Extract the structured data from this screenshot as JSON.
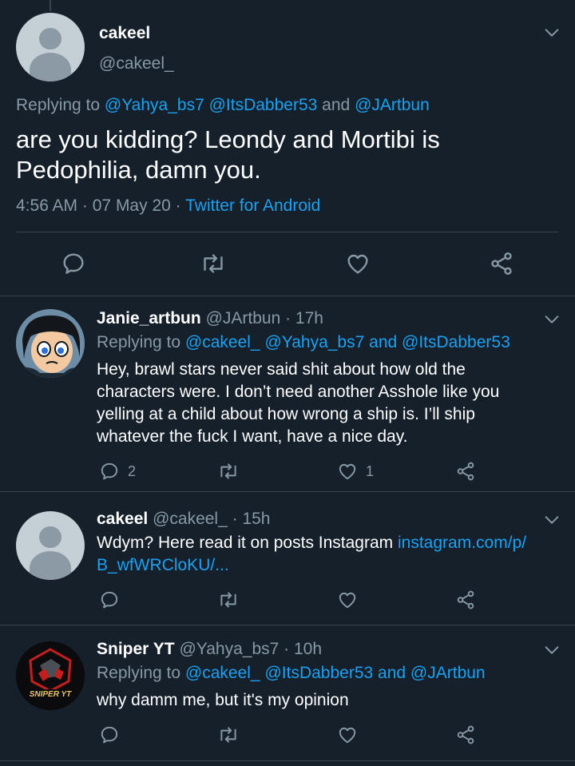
{
  "main_tweet": {
    "author_name": "cakeel",
    "author_handle": "@cakeel_",
    "replying_prefix": "Replying to",
    "replying_mentions": [
      "@Yahya_bs7",
      "@ItsDabber53"
    ],
    "replying_and": "and",
    "replying_last": "@JArtbun",
    "text_line1": "are you kidding? Leondy and Mortibi is",
    "text_line2": "Pedophilia, damn you.",
    "time": "4:56 AM",
    "dot": "·",
    "date": "07 May 20",
    "source": "Twitter for Android"
  },
  "replies": [
    {
      "name": "Janie_artbun",
      "handle": "@JArtbun",
      "age": "· 17h",
      "replying_prefix": "Replying to",
      "mention1": "@cakeel_",
      "mention2": "@Yahya_bs7",
      "and": "and",
      "mention3": "@ItsDabber53",
      "lines": [
        "Hey, brawl stars never said shit about how old the",
        "characters were. I don’t need another Asshole like you",
        "yelling at a child about how wrong a ship is. I’ll ship",
        "whatever the fuck I want, have a nice day."
      ],
      "reply_count": "2",
      "like_count": "1"
    },
    {
      "name": "cakeel",
      "handle": "@cakeel_",
      "age": "· 15h",
      "text": "Wdym? Here read it on posts Instagram",
      "link_line1": "instagram.com/p/",
      "link_line2": "B_wfWRCloKU/..."
    },
    {
      "name": "Sniper YT",
      "handle": "@Yahya_bs7",
      "age": "· 10h",
      "replying_prefix": "Replying to",
      "mention1": "@cakeel_",
      "mention2": "@ItsDabber53",
      "and": "and",
      "mention3": "@JArtbun",
      "text": "why damm me, but it's my opinion",
      "avatar_text": "SNIPER YT"
    }
  ],
  "colors": {
    "background": "#15202b",
    "accent": "#1da1f2",
    "muted": "#8899a6",
    "divider": "#38444d"
  },
  "icons": [
    "reply-icon",
    "retweet-icon",
    "like-icon",
    "share-icon",
    "chevron-down-icon"
  ]
}
